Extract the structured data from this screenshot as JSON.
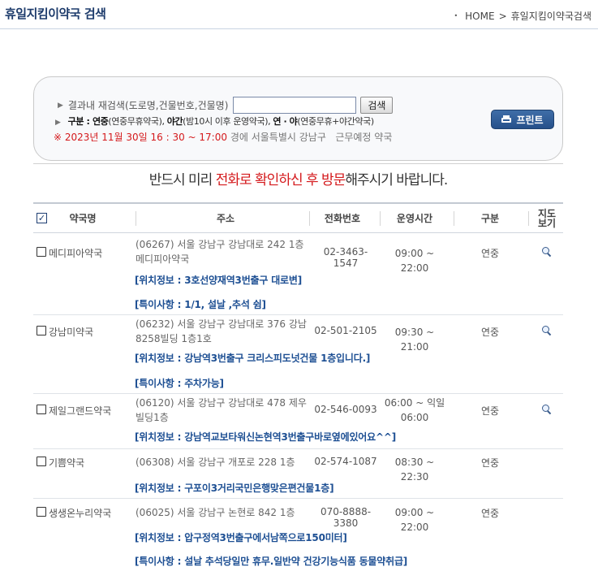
{
  "header": {
    "title": "휴일지킴이약국 검색",
    "breadcrumb": [
      "HOME",
      "휴일지킴이약국검색"
    ],
    "breadcrumb_sep": ">"
  },
  "search": {
    "label": "결과내 재검색(도로명,건물번호,건물명)",
    "input_value": "",
    "button_label": "검색",
    "legend_label": "구분 : ",
    "legend_items": [
      {
        "term": "연중",
        "desc": "(연중무휴약국)"
      },
      {
        "term": "야간",
        "desc": "(밤10시 이후 운영약국)"
      },
      {
        "term": "연 · 야",
        "desc": "(연중무휴+야간약국)"
      }
    ],
    "legend_sep": ", ",
    "date_text": "※ 2023년 11월 30일 16 : 30 ~ 17:00",
    "date_suffix": " 경에 ",
    "region_text": "서울특별시  강남구",
    "duty_text": "근무예정 약국",
    "print_label": "프린트"
  },
  "notice": {
    "pre": "반드시 미리 ",
    "highlight": "전화로 확인하신 후 방문",
    "post": "해주시기 바랍니다."
  },
  "table": {
    "headers": {
      "name": "약국명",
      "address": "주소",
      "phone": "전화번호",
      "hours": "운영시간",
      "kind": "구분",
      "map_line1": "지도",
      "map_line2": "보기"
    },
    "rows": [
      {
        "name": "메디피아약국",
        "address": "(06267) 서울 강남구 강남대로 242 1층 메디피아약국",
        "phone": "02-3463-1547",
        "hours": "09:00 ~ 22:00",
        "kind": "연중",
        "location": "[위치정보 : 3호선양재역3번출구 대로변]",
        "note": "[특이사항 : 1/1, 설날 ,추석 쉼]"
      },
      {
        "name": "강남미약국",
        "address": "(06232) 서울 강남구 강남대로 376 강남8258빌딩 1층1호",
        "phone": "02-501-2105",
        "hours": "09:30 ~ 21:00",
        "kind": "연중",
        "location": "[위치정보 : 강남역3번출구 크리스피도넛건물 1층입니다.]",
        "note": "[특이사항 : 주차가능]"
      },
      {
        "name": "제일그랜드약국",
        "address": "(06120) 서울 강남구 강남대로 478 제우빌딩1층",
        "phone": "02-546-0093",
        "hours": "06:00 ~ 익일 06:00",
        "kind": "연중",
        "location": "[위치정보 : 강남역교보타워신논현역3번출구바로옆에있어요^^]",
        "note": ""
      },
      {
        "name": "기쁨약국",
        "address": "(06308) 서울 강남구 개포로 228 1층",
        "phone": "02-574-1087",
        "hours": "08:30 ~ 22:30",
        "kind": "연중",
        "location": "[위치정보 : 구포이3거리국민은행맞은편건물1층]",
        "note": ""
      },
      {
        "name": "생생온누리약국",
        "address": "(06025) 서울 강남구 논현로 842 1층",
        "phone": "070-8888-3380",
        "hours": "09:00 ~ 22:00",
        "kind": "연중",
        "location": "[위치정보 : 압구정역3번출구에서남쪽으로150미터]",
        "note": "[특이사항 : 설날 추석당일만 휴무.일반약 건강기능식품 동물약취급]"
      }
    ]
  },
  "colors": {
    "title": "#1d3b6b",
    "accent_red": "#d4191c",
    "info_blue": "#1d4f93",
    "print_button": "#26508a"
  },
  "icons": [
    "printer-icon",
    "magnifier-icon",
    "checkbox-icon",
    "triangle-bullet-icon"
  ]
}
